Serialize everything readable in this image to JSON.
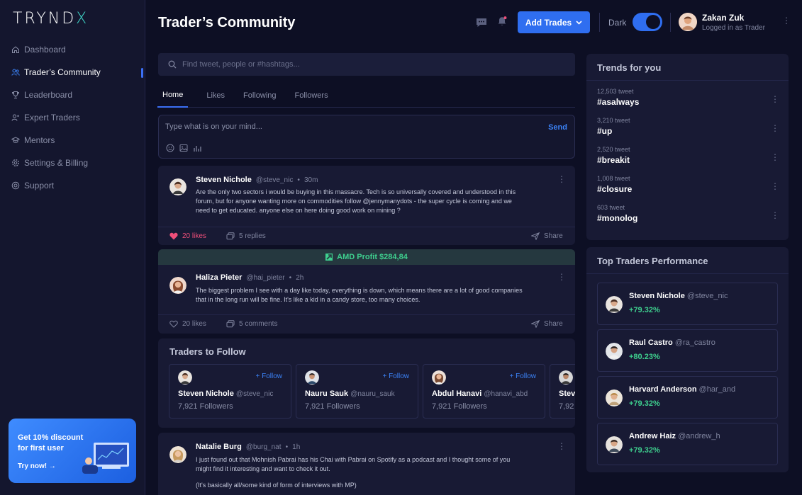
{
  "app": {
    "logo": "TRYNDX",
    "logo_main": "TRYND",
    "logo_accent": "X"
  },
  "sidebar": {
    "items": [
      {
        "label": "Dashboard",
        "icon": "home-icon"
      },
      {
        "label": "Trader’s Community",
        "icon": "users-icon",
        "active": true
      },
      {
        "label": "Leaderboard",
        "icon": "trophy-icon"
      },
      {
        "label": "Expert Traders",
        "icon": "expert-icon"
      },
      {
        "label": "Mentors",
        "icon": "graduation-cap-icon"
      },
      {
        "label": "Settings & Billing",
        "icon": "gear-icon"
      },
      {
        "label": "Support",
        "icon": "support-icon"
      }
    ],
    "promo": {
      "line1": "Get 10% discount",
      "line2": "for first user",
      "cta": "Try now!"
    }
  },
  "header": {
    "title": "Trader’s Community",
    "add_trades_label": "Add Trades",
    "dark_label": "Dark",
    "dark_enabled": true,
    "user": {
      "name": "Zakan Zuk",
      "role": "Logged in as Trader"
    }
  },
  "search": {
    "placeholder": "Find tweet, people or #hashtags..."
  },
  "tabs": [
    "Home",
    "Likes",
    "Following",
    "Followers"
  ],
  "composer": {
    "placeholder": "Type what is on your mind...",
    "send_label": "Send"
  },
  "posts": [
    {
      "name": "Steven Nichole",
      "handle": "@steve_nic",
      "time": "30m",
      "lines": [
        "Are the only two sectors i would be buying in this massacre. Tech is so universally covered and understood in this",
        "forum, but for anyone wanting more on commodities follow @jennymanydots -  the super cycle is coming and we",
        "need to get educated. anyone else on here doing good work on mining ?"
      ],
      "likes": "20 likes",
      "replies": "5 replies",
      "share": "Share",
      "liked": true
    },
    {
      "banner": "AMD Profit $284,84",
      "name": "Haliza Pieter",
      "handle": "@hai_pieter",
      "time": "2h",
      "lines": [
        "The biggest problem I see with a day like today, everything is down, which means there are a lot of good companies",
        "that in the long run will be fine.  It's like a kid in a candy store, too many choices."
      ],
      "likes": "20 likes",
      "replies": "5 comments",
      "share": "Share",
      "liked": false
    },
    {
      "name": "Natalie Burg",
      "handle": "@burg_nat",
      "time": "1h",
      "lines": [
        "I just found out that Mohnish Pabrai has his Chai with Pabrai on Spotify as a podcast and I thought some of you",
        "might find it interesting and want to check it out.",
        "(It's basically all/some kind of form of interviews with MP)"
      ]
    }
  ],
  "traders_to_follow": {
    "title": "Traders to Follow",
    "follow_label": "+ Follow",
    "cards": [
      {
        "name": "Steven Nichole",
        "handle": "@steve_nic",
        "followers": "7,921 Followers"
      },
      {
        "name": "Nauru Sauk",
        "handle": "@nauru_sauk",
        "followers": "7,921 Followers"
      },
      {
        "name": "Abdul Hanavi",
        "handle": "@hanavi_abd",
        "followers": "7,921 Followers"
      },
      {
        "name": "Stev",
        "handle": "",
        "followers": "7,92"
      }
    ]
  },
  "trends": {
    "title": "Trends for you",
    "items": [
      {
        "count": "12,503 tweet",
        "tag": "#asalways"
      },
      {
        "count": "3,210 tweet",
        "tag": "#up"
      },
      {
        "count": "2,520 tweet",
        "tag": "#breakit"
      },
      {
        "count": "1,008 tweet",
        "tag": "#closure"
      },
      {
        "count": "603 tweet",
        "tag": "#monolog"
      }
    ]
  },
  "top_traders": {
    "title": "Top Traders Performance",
    "items": [
      {
        "name": "Steven Nichole",
        "handle": "@steve_nic",
        "perf": "+79.32%"
      },
      {
        "name": "Raul Castro",
        "handle": "@ra_castro",
        "perf": "+80.23%"
      },
      {
        "name": "Harvard Anderson",
        "handle": "@har_and",
        "perf": "+79.32%"
      },
      {
        "name": "Andrew Haiz",
        "handle": "@andrew_h",
        "perf": "+79.32%"
      }
    ]
  },
  "colors": {
    "accent": "#2f6ef0",
    "positive": "#3ecf8e",
    "like": "#ef4f7a",
    "background": "#0d0f24"
  }
}
